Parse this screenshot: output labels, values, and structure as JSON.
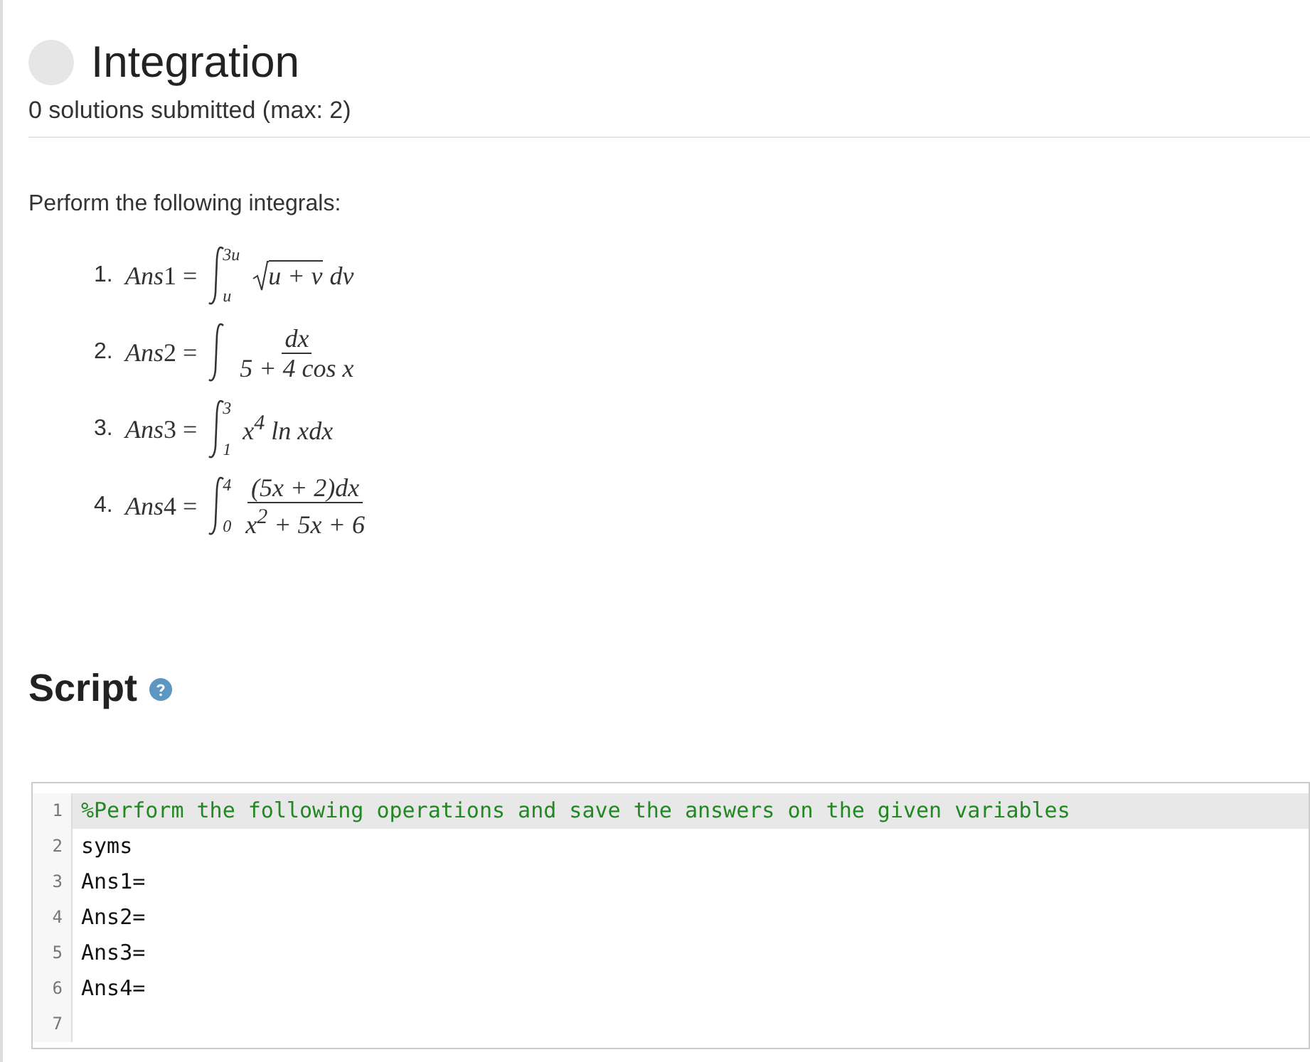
{
  "header": {
    "title": "Integration",
    "status": "0 solutions submitted (max: 2)"
  },
  "problem": {
    "intro": "Perform the following integrals:",
    "integrals": [
      {
        "number": "1.",
        "variable": "Ans",
        "suffix": "1 =",
        "upper": "3u",
        "lower": "u",
        "kind": "sqrt",
        "radicand": "u + v",
        "tail": "dv"
      },
      {
        "number": "2.",
        "variable": "Ans",
        "suffix": "2 =",
        "kind": "fraction",
        "numerator": "dx",
        "denominator": "5 + 4 cos x"
      },
      {
        "number": "3.",
        "variable": "Ans",
        "suffix": "3 =",
        "upper": "3",
        "lower": "1",
        "kind": "plain",
        "body": "x$^{4}$ ln xdx"
      },
      {
        "number": "4.",
        "variable": "Ans",
        "suffix": "4 =",
        "upper": "4",
        "lower": "0",
        "kind": "fraction",
        "numerator": "(5x + 2)dx",
        "denominator": "x$^{2}$ + 5x + 6"
      }
    ]
  },
  "script": {
    "title": "Script",
    "lines": [
      {
        "number": "1",
        "text": "%Perform the following operations and save the answers on the given variables",
        "kind": "comment",
        "active": true
      },
      {
        "number": "2",
        "text": "syms",
        "kind": "code",
        "active": false
      },
      {
        "number": "3",
        "text": "Ans1=",
        "kind": "code",
        "active": false
      },
      {
        "number": "4",
        "text": "Ans2=",
        "kind": "code",
        "active": false
      },
      {
        "number": "5",
        "text": "Ans3=",
        "kind": "code",
        "active": false
      },
      {
        "number": "6",
        "text": "Ans4=",
        "kind": "code",
        "active": false
      },
      {
        "number": "7",
        "active": false
      }
    ]
  }
}
